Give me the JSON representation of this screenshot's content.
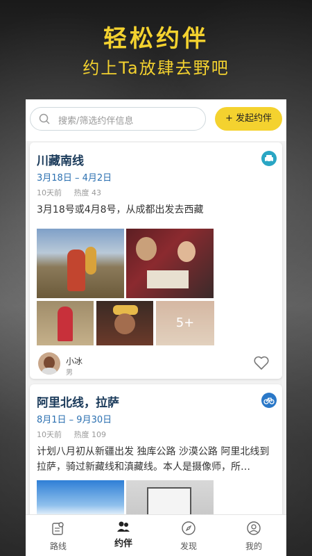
{
  "hero": {
    "title": "轻松约伴",
    "subtitle": "约上Ta放肆去野吧"
  },
  "search": {
    "placeholder": "搜索/筛选约伴信息"
  },
  "actions": {
    "launch_label": "+ 发起约伴"
  },
  "posts": [
    {
      "title": "川藏南线",
      "date_range": "3月18日 – 4月2日",
      "posted": "10天前",
      "heat": "热度 43",
      "description": "3月18号或4月8号，从成都出发去西藏",
      "transport_icon": "car-icon",
      "more_photos": "5+",
      "author": {
        "name": "小冰",
        "gender": "男"
      }
    },
    {
      "title": "阿里北线，拉萨",
      "date_range": "8月1日 – 9月30日",
      "posted": "10天前",
      "heat": "热度 109",
      "description": "计划八月初从新疆出发 独库公路 沙漠公路  阿里北线到拉萨，骑过新藏线和滇藏线。本人是摄像师，所…",
      "transport_icon": "bicycle-icon"
    }
  ],
  "tabs": [
    {
      "label": "路线",
      "icon": "route-icon"
    },
    {
      "label": "约伴",
      "icon": "companions-icon",
      "active": true
    },
    {
      "label": "发现",
      "icon": "compass-icon"
    },
    {
      "label": "我的",
      "icon": "profile-icon"
    }
  ],
  "colors": {
    "accent": "#f4d22f",
    "title": "#1a3a5a",
    "date": "#2a6fb0"
  }
}
